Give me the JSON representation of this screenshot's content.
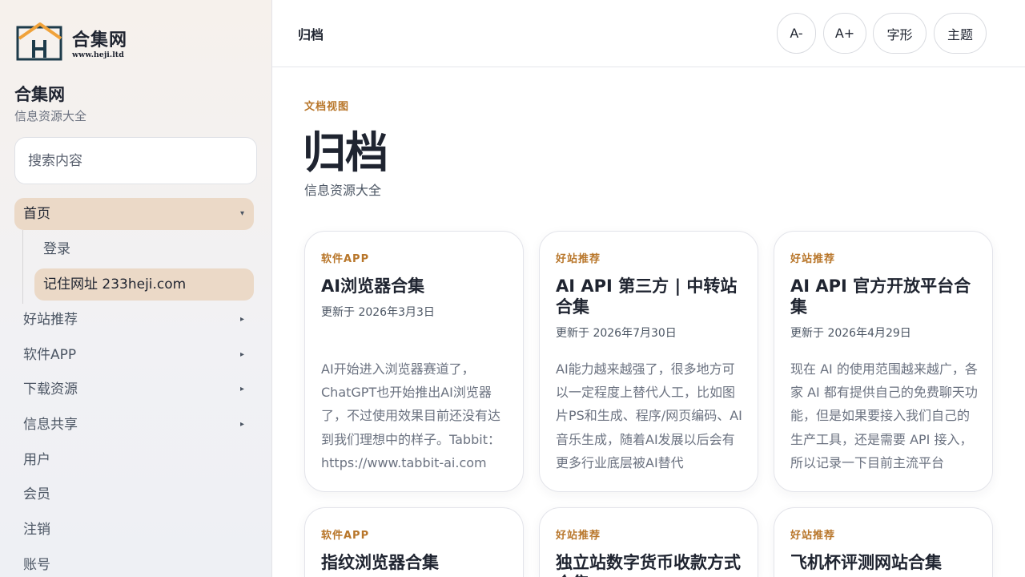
{
  "site": {
    "logo_text": "合集网",
    "logo_url": "www.heji.ltd",
    "title": "合集网",
    "subtitle": "信息资源大全",
    "search_placeholder": "搜索内容"
  },
  "nav": {
    "home": "首页",
    "sub_items": [
      "登录",
      "记住网址 233heji.com"
    ],
    "items": [
      {
        "label": "好站推荐",
        "has_children": true
      },
      {
        "label": "软件APP",
        "has_children": true
      },
      {
        "label": "下载资源",
        "has_children": true
      },
      {
        "label": "信息共享",
        "has_children": true
      },
      {
        "label": "用户",
        "has_children": false
      },
      {
        "label": "会员",
        "has_children": false
      },
      {
        "label": "注销",
        "has_children": false
      },
      {
        "label": "账号",
        "has_children": false
      }
    ],
    "caret_down": "▾",
    "caret_right": "▸"
  },
  "topbar": {
    "title": "归档",
    "buttons": [
      "A-",
      "A+",
      "字形",
      "主题"
    ]
  },
  "main": {
    "kicker": "文档视图",
    "title": "归档",
    "subtitle": "信息资源大全"
  },
  "cards": [
    {
      "category": "软件APP",
      "title": "AI浏览器合集",
      "date": "更新于 2026年3月3日",
      "excerpt": "AI开始进入浏览器赛道了，ChatGPT也开始推出AI浏览器了，不过使用效果目前还没有达到我们理想中的样子。Tabbit：https://www.tabbit-ai.com"
    },
    {
      "category": "好站推荐",
      "title": "AI API 第三方 | 中转站合集",
      "date": "更新于 2026年7月30日",
      "excerpt": "AI能力越来越强了，很多地方可以一定程度上替代人工，比如图片PS和生成、程序/网页编码、AI音乐生成，随着AI发展以后会有更多行业底层被AI替代"
    },
    {
      "category": "好站推荐",
      "title": "AI API 官方开放平台合集",
      "date": "更新于 2026年4月29日",
      "excerpt": "现在 AI 的使用范围越来越广，各家 AI 都有提供自己的免费聊天功能，但是如果要接入我们自己的生产工具，还是需要 API 接入，所以记录一下目前主流平台"
    },
    {
      "category": "软件APP",
      "title": "指纹浏览器合集",
      "date": "",
      "excerpt": ""
    },
    {
      "category": "好站推荐",
      "title": "独立站数字货币收款方式合集",
      "date": "",
      "excerpt": ""
    },
    {
      "category": "好站推荐",
      "title": "飞机杯评测网站合集",
      "date": "",
      "excerpt": ""
    }
  ]
}
